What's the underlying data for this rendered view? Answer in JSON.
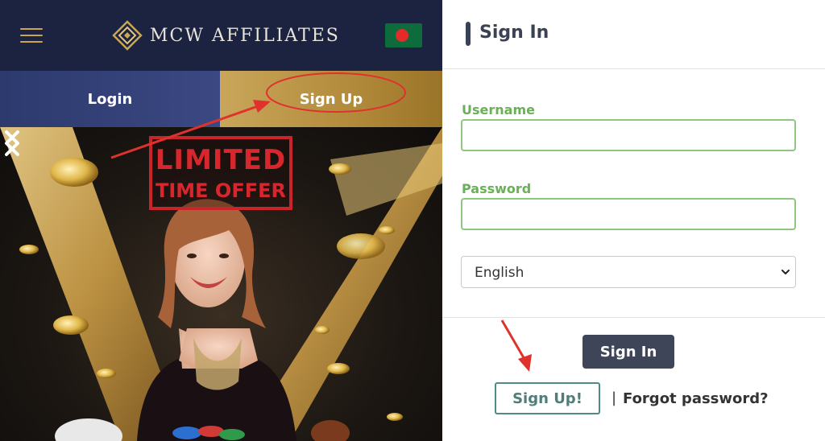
{
  "header": {
    "logo_text": "MCW AFFILIATES",
    "hamburger_icon": "menu-icon",
    "flag_icon": "bangladesh-flag-icon"
  },
  "tabs": {
    "login_label": "Login",
    "signup_label": "Sign Up"
  },
  "banner": {
    "offer_line1": "LIMITED",
    "offer_line2": "TIME OFFER",
    "prev_icon": "chevron-left-icon",
    "next_icon": "chevron-right-icon"
  },
  "signin": {
    "title": "Sign In",
    "username_label": "Username",
    "username_value": "",
    "password_label": "Password",
    "password_value": "",
    "language": {
      "selected": "English",
      "options": [
        "English"
      ]
    },
    "signin_button": "Sign In",
    "signup_button": "Sign Up!",
    "separator": "|",
    "forgot_password": "Forgot password?"
  },
  "colors": {
    "header_bg": "#1c2340",
    "login_tab": "#2d3a6e",
    "signup_tab": "#b28a3b",
    "field_label": "#6ab058",
    "field_border": "#8cc77f",
    "signin_button": "#3f4558",
    "signup_button_border": "#4f8a86",
    "annotation": "#e0322c"
  }
}
